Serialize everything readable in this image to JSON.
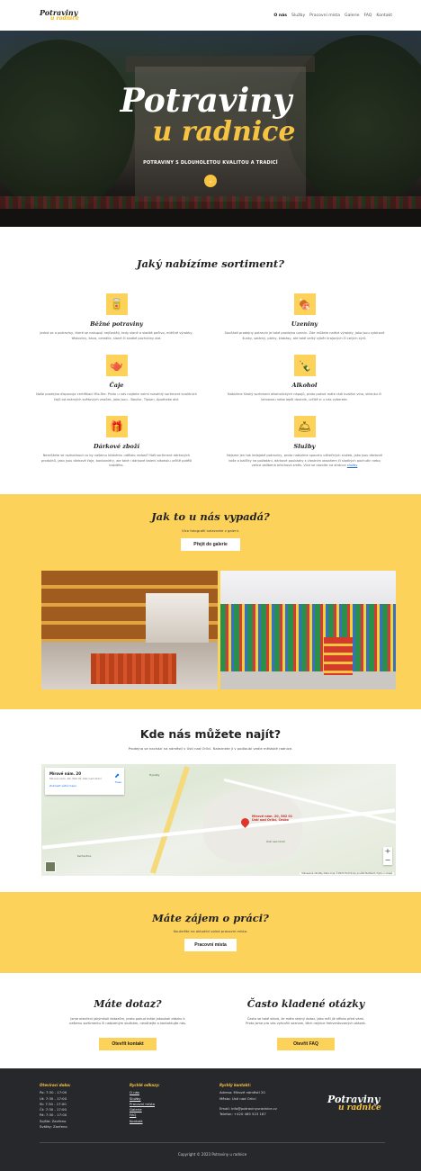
{
  "nav": {
    "logo_line1": "Potraviny",
    "logo_line2": "u radnice",
    "items": [
      "O nás",
      "Služby",
      "Pracovní místa",
      "Galerie",
      "FAQ",
      "Kontakt"
    ]
  },
  "hero": {
    "title1": "Potraviny",
    "title2": "u radnice",
    "subtitle": "POTRAVINY S DLOUHOLETOU KVALITOU A TRADICÍ",
    "scroll_icon": "chevron-down-icon"
  },
  "sortiment": {
    "title": "Jaký nabízíme sortiment?",
    "items": [
      {
        "icon": "🥫",
        "icon_name": "groceries-icon",
        "title": "Běžné potraviny",
        "text": "Jedná se o potraviny, které se nakupují nejčastěji, tedy slané a sladké pečivo, mléčné výrobky, těstoviny, káva, cereálie, slané či sladké pochutiny atd."
      },
      {
        "icon": "🍖",
        "icon_name": "sausage-icon",
        "title": "Uzeniny",
        "text": "Součástí prodejny potravin je také prodejna uzenin. Zde můžete nalézt výrobky, jako jsou vybírové šunky, salámy, párky, klobásy, ale také velký výběr krajových či celých sýrů."
      },
      {
        "icon": "🫖",
        "icon_name": "teapot-icon",
        "title": "Čaje",
        "text": "Naše prodejna disponuje certifikací Mix-Tee. Proto u nás najdete velmi rozsáhlý sortiment kvalitních čajů od známých světových značek, jako jsou - Basilur, Tipson, Apotheke atd."
      },
      {
        "icon": "🍾",
        "icon_name": "bottles-icon",
        "title": "Alkohol",
        "text": "Nabízíme široký sortiment alkoholických nápojů, proto pokud máte rádi kvalitní vína, sklenku či lahvovou nebo lepší doutník, určitě si u nás vyberete."
      },
      {
        "icon": "🎁",
        "icon_name": "gift-icon",
        "title": "Dárkové zboží",
        "text": "Nemůžete se rozhodnout co by vašemu blízkému udělalo radost? Náš sortiment dárkových produktů, jako jsou dárkové čaje, bonboniéry, ale také i dárkové balení alkoholu určitě potěší každého."
      },
      {
        "icon": "🛎",
        "icon_name": "service-bell-icon",
        "title": "Služby",
        "text": "Nejsme jen tak ledajaké potraviny, proto nabízíme spoustu užitečných služeb, jako jsou dárkové koše a balíčky na požádání, dárkové poukázky s vlastním obsahem či sladkých pochutin nebo velice oblíbená ořechová směs. Více se dozvíte na stránce",
        "link": "služby"
      }
    ]
  },
  "gallery": {
    "title": "Jak to u nás vypadá?",
    "subtitle": "Více fotografií naleznete v galerii.",
    "button": "Přejít do galerie"
  },
  "map_section": {
    "title": "Kde nás můžete najít?",
    "subtitle": "Prodejna se nachází na náměstí v Ústí nad Orlicí. Naleznete ji v podloubí vedle městské radnice.",
    "card_title": "Mírové nám. 20",
    "card_address": "Mírové nám. 20, 562 01 Ústí nad Orlicí",
    "card_link": "Zobrazit větší mapu",
    "directions": "Trasa",
    "pin_label_1": "Mírové nám. 20, 562 01",
    "pin_label_2": "Ústí nad Orlicí, Česko",
    "place_1": "Ústí nad Orlicí",
    "place_2": "Hylváty",
    "place_3": "Kerhartice",
    "zoom_in": "+",
    "zoom_out": "−",
    "attribution": "Klávesové zkratky  Data map ©2023  Podmínky použití  Nahlásit chybu v mapě"
  },
  "jobs": {
    "title": "Máte zájem o práci?",
    "subtitle": "Koukněte na aktuální volná pracovní místa.",
    "button": "Pracovní místa"
  },
  "contact": {
    "title": "Máte dotaz?",
    "text": "Jsme otevřeni jakýmkoli dotazům, proto pokud máte jakoukoli otázku k našemu sortimentu či nabízeným službám, neváhejte a kontaktujte nás.",
    "button": "Otevřít kontakt"
  },
  "faq": {
    "title": "Často kladené otázky",
    "text": "Často se také stává, že máte stejný dotaz, jako měl již někdo před vámi. Proto jsme pro vás vytvořili seznam, těch nejvíce frekventovaných otázek.",
    "button": "Otevřít FAQ"
  },
  "footer": {
    "hours_title": "Otevírací doba:",
    "hours": [
      "Po: 7:30 - 17:00",
      "Út: 7:30 - 17:00",
      "St: 7:30 - 17:00",
      "Čt: 7:30 - 17:00",
      "Pá: 7:30 - 17:00",
      "So/Ne: Zavřeno",
      "Svátky: Zavřeno"
    ],
    "links_title": "Rychlé odkazy:",
    "links": [
      "O nás",
      "Služby",
      "Pracovní místa",
      "Galerie",
      "FAQ",
      "Kontakt"
    ],
    "contact_title": "Rychlý kontakt:",
    "address": "Adresa: Mírové náměstí 20",
    "city": "Město: Ústí nad Orlicí",
    "email": "Email: info@potravinyuradnice.cz",
    "phone": "Telefon: +420 465 523 187",
    "logo_line1": "Potraviny",
    "logo_line2": "u radnice",
    "copyright": "Copyright © 2023 Potraviny u radnice"
  },
  "colors": {
    "accent": "#fdd25a",
    "dark": "#26282c"
  }
}
